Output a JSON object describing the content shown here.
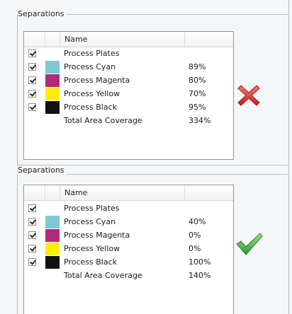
{
  "panels": [
    {
      "title": "Separations",
      "column_header": "Name",
      "rows": [
        {
          "checked": true,
          "swatch": "",
          "name": "Process Plates",
          "value": ""
        },
        {
          "checked": true,
          "swatch": "#7ec9d3",
          "name": "Process Cyan",
          "value": "89%"
        },
        {
          "checked": true,
          "swatch": "#b0297d",
          "name": "Process Magenta",
          "value": "80%"
        },
        {
          "checked": true,
          "swatch": "#ffee00",
          "name": "Process Yellow",
          "value": "70%"
        },
        {
          "checked": true,
          "swatch": "#111111",
          "name": "Process Black",
          "value": "95%"
        },
        {
          "checked": false,
          "swatch": "",
          "name": "Total Area Coverage",
          "value": "334%"
        }
      ],
      "status_icon": "red-x-icon",
      "status_color": "#d62a2a"
    },
    {
      "title": "Separations",
      "column_header": "Name",
      "rows": [
        {
          "checked": true,
          "swatch": "",
          "name": "Process Plates",
          "value": ""
        },
        {
          "checked": true,
          "swatch": "#7ec9d3",
          "name": "Process Cyan",
          "value": "40%"
        },
        {
          "checked": true,
          "swatch": "#b0297d",
          "name": "Process Magenta",
          "value": "0%"
        },
        {
          "checked": true,
          "swatch": "#ffee00",
          "name": "Process Yellow",
          "value": "0%"
        },
        {
          "checked": true,
          "swatch": "#111111",
          "name": "Process Black",
          "value": "100%"
        },
        {
          "checked": false,
          "swatch": "",
          "name": "Total Area Coverage",
          "value": "140%"
        }
      ],
      "status_icon": "green-checkmark-icon",
      "status_color": "#3aa63a"
    }
  ]
}
